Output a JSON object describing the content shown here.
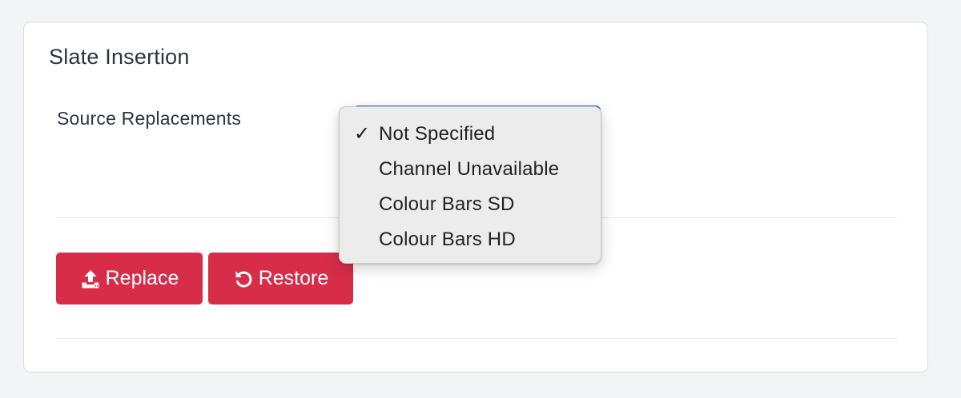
{
  "card": {
    "title": "Slate Insertion"
  },
  "form": {
    "field_label": "Source Replacements",
    "select": {
      "selected_value": "Not Specified",
      "options": [
        {
          "label": "Not Specified",
          "checked": true
        },
        {
          "label": "Channel Unavailable",
          "checked": false
        },
        {
          "label": "Colour Bars SD",
          "checked": false
        },
        {
          "label": "Colour Bars HD",
          "checked": false
        }
      ],
      "checkmark": "✓",
      "focus_color": "#2f6fe0"
    }
  },
  "actions": {
    "replace_label": "Replace",
    "replace_icon": "upload-icon",
    "restore_label": "Restore",
    "restore_icon": "undo-icon",
    "button_color": "#d72d48"
  }
}
